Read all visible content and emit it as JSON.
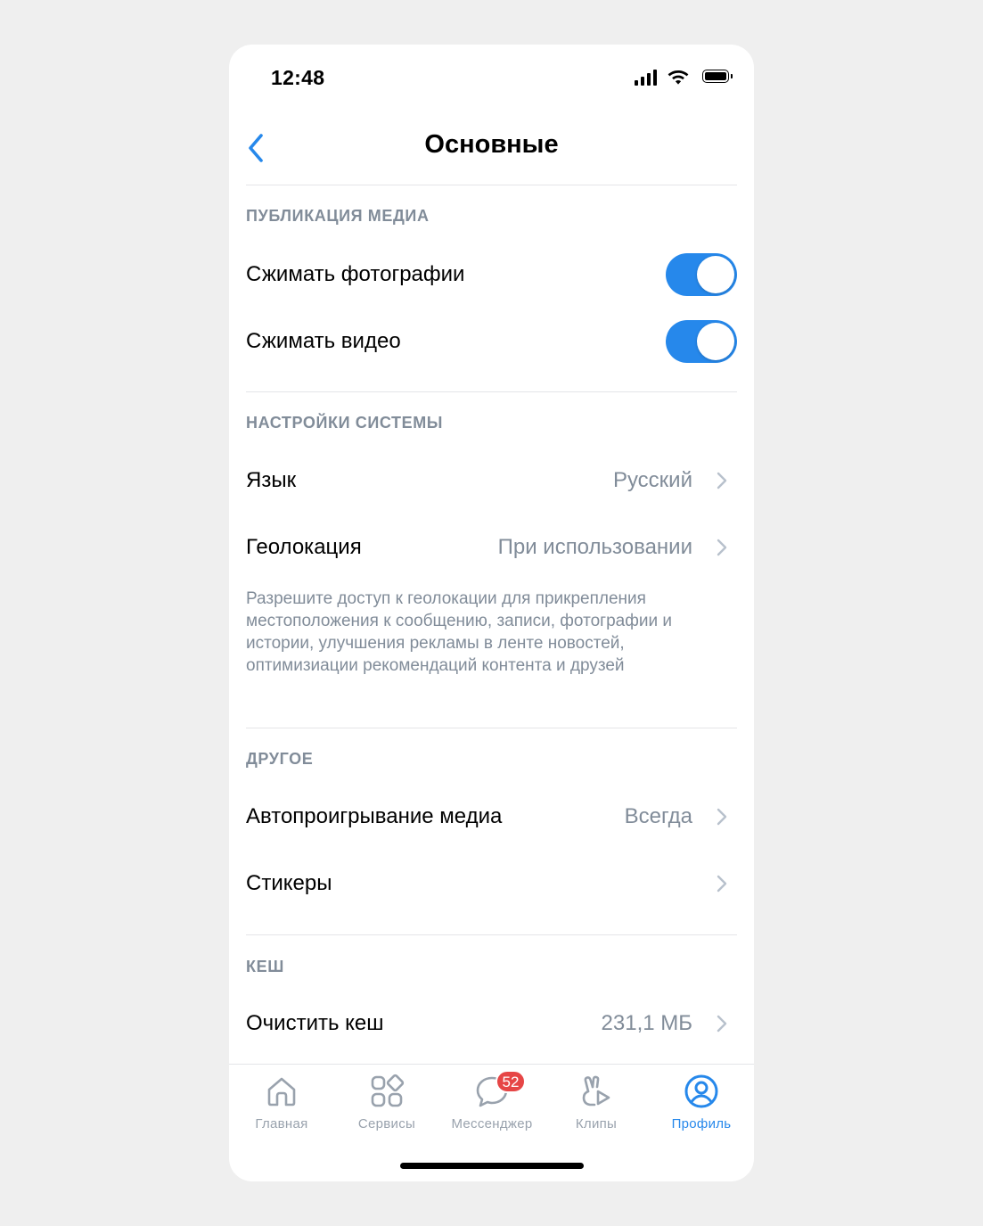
{
  "status_bar": {
    "time": "12:48"
  },
  "nav": {
    "title": "Основные"
  },
  "sections": {
    "media": {
      "header": "ПУБЛИКАЦИЯ МЕДИА",
      "compress_photos": {
        "label": "Сжимать фотографии",
        "enabled": true
      },
      "compress_video": {
        "label": "Сжимать видео",
        "enabled": true
      }
    },
    "system": {
      "header": "НАСТРОЙКИ СИСТЕМЫ",
      "language": {
        "label": "Язык",
        "value": "Русский"
      },
      "geolocation": {
        "label": "Геолокация",
        "value": "При использовании",
        "description": "Разрешите доступ к геолокации для прикрепления местоположения к сообщению, записи, фотографии и истории, улучшения рекламы в ленте новостей, оптимизиации рекомендаций контента и друзей"
      }
    },
    "other": {
      "header": "ДРУГОЕ",
      "autoplay": {
        "label": "Автопроигрывание медиа",
        "value": "Всегда"
      },
      "stickers": {
        "label": "Стикеры"
      }
    },
    "cache": {
      "header": "КЕШ",
      "clear": {
        "label": "Очистить кеш",
        "value": "231,1 МБ"
      }
    }
  },
  "tabbar": {
    "home": "Главная",
    "services": "Сервисы",
    "messenger": "Мессенджер",
    "messenger_badge": "52",
    "clips": "Клипы",
    "profile": "Профиль",
    "active": "profile"
  },
  "colors": {
    "accent": "#2688eb",
    "secondary_text": "#818c99",
    "badge": "#e64646",
    "divider": "#e4e5e8",
    "page_background": "#efefef"
  }
}
